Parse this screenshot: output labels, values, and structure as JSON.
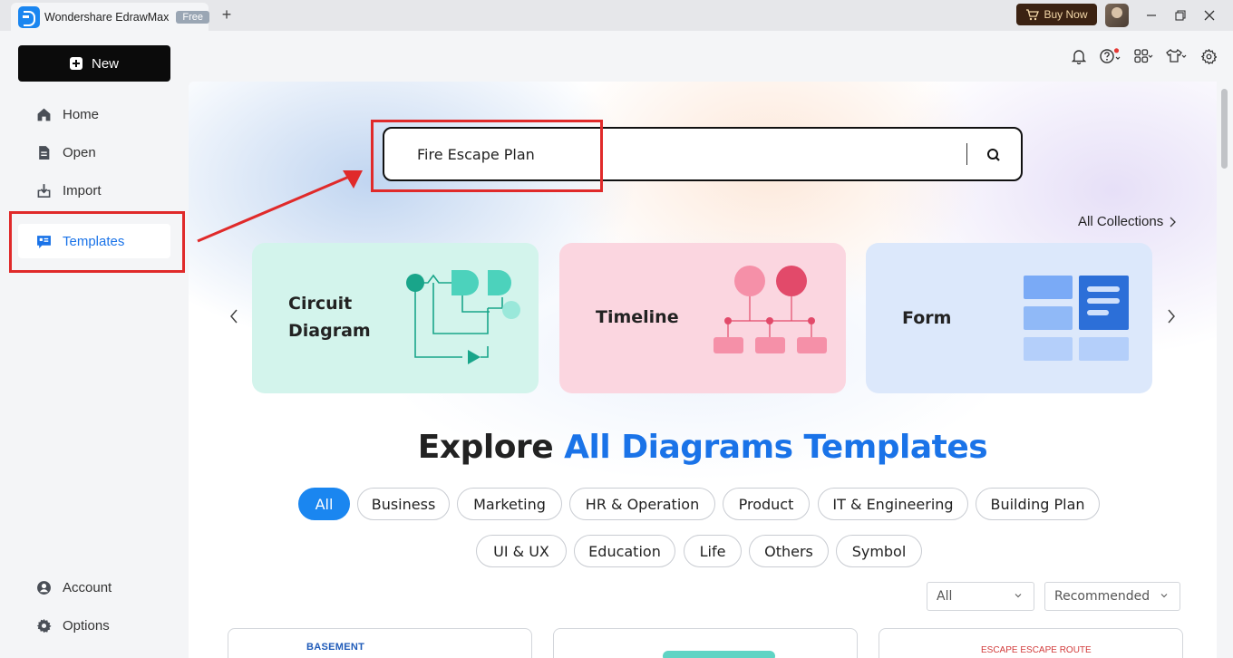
{
  "titlebar": {
    "app_name": "Wondershare EdrawMax",
    "badge": "Free",
    "new_tab_symbol": "+",
    "buy_now": "Buy Now",
    "accent": "#1a86f0"
  },
  "sidebar": {
    "new_label": "New",
    "items": [
      {
        "label": "Home",
        "icon": "home-icon"
      },
      {
        "label": "Open",
        "icon": "document-icon"
      },
      {
        "label": "Import",
        "icon": "import-icon"
      },
      {
        "label": "Templates",
        "icon": "templates-icon",
        "active": true
      }
    ],
    "bottom_items": [
      {
        "label": "Account",
        "icon": "account-icon"
      },
      {
        "label": "Options",
        "icon": "gear-icon"
      }
    ]
  },
  "toolbar": {
    "icons": [
      "bell-icon",
      "help-icon",
      "apps-icon",
      "shirt-icon",
      "settings-icon"
    ]
  },
  "search": {
    "value": "Fire Escape Plan"
  },
  "collections": {
    "link": "All Collections"
  },
  "carousel": {
    "cards": [
      {
        "title_line1": "Circuit",
        "title_line2": "Diagram",
        "color": "#d4f5ee"
      },
      {
        "title": "Timeline",
        "color": "#fcd8e2"
      },
      {
        "title": "Form",
        "color": "#dce8fb"
      }
    ]
  },
  "explore": {
    "prefix": "Explore",
    "highlight": "All Diagrams Templates"
  },
  "categories": {
    "row1": [
      "All",
      "Business",
      "Marketing",
      "HR & Operation",
      "Product",
      "IT & Engineering",
      "Building Plan"
    ],
    "row2": [
      "UI & UX",
      "Education",
      "Life",
      "Others",
      "Symbol"
    ]
  },
  "filters": {
    "type": "All",
    "sort": "Recommended"
  },
  "thumbnails": {
    "first_label": "BASEMENT",
    "third_label": "ESCAPE ESCAPE ROUTE"
  }
}
